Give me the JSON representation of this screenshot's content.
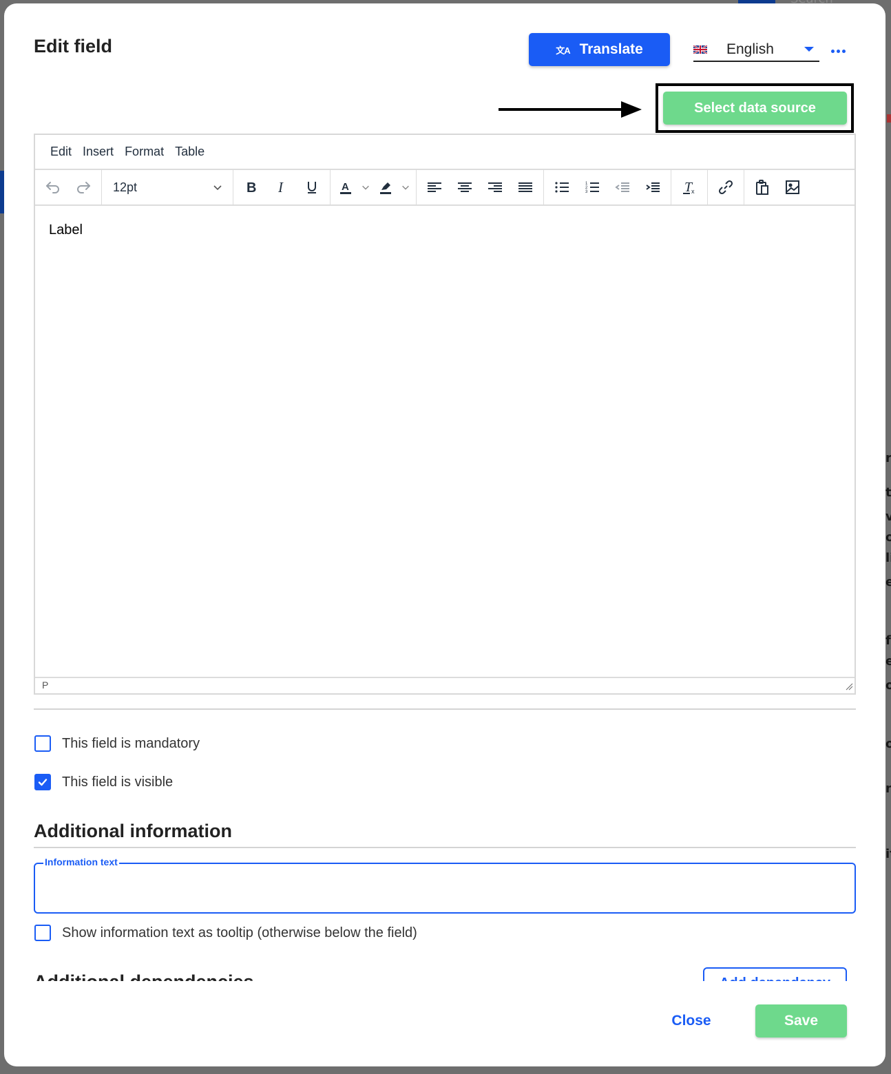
{
  "background": {
    "search_placeholder": "Search",
    "right_edge_fragments": [
      "re",
      "ti",
      "v",
      "ot",
      "li",
      "e",
      "f",
      "ec",
      "o",
      "og",
      "n",
      "it"
    ]
  },
  "dialog": {
    "title": "Edit field",
    "translate_button": {
      "label": "Translate",
      "icon": "translate-icon"
    },
    "language": {
      "selected": "English",
      "flag": "uk-flag-icon"
    },
    "more_menu": {
      "icon": "more-horizontal-icon"
    },
    "select_data_source_button": {
      "label": "Select data source",
      "highlighted": true
    }
  },
  "editor": {
    "menubar": [
      "Edit",
      "Insert",
      "Format",
      "Table"
    ],
    "toolbar": {
      "undo": "undo-icon",
      "redo": "redo-icon",
      "font_size": "12pt",
      "formatting": [
        "bold-icon",
        "italic-icon",
        "underline-icon"
      ],
      "colors": [
        "text-color-icon",
        "highlight-color-icon"
      ],
      "alignment": [
        "align-left-icon",
        "align-center-icon",
        "align-right-icon",
        "align-justify-icon"
      ],
      "lists": [
        "bullet-list-icon",
        "numbered-list-icon",
        "outdent-icon",
        "indent-icon"
      ],
      "clear_formatting": "clear-formatting-icon",
      "link": "link-icon",
      "paste": "paste-icon",
      "image": "image-icon"
    },
    "content": "Label",
    "status_path": "P"
  },
  "options": {
    "mandatory": {
      "label": "This field is mandatory",
      "checked": false
    },
    "visible": {
      "label": "This field is visible",
      "checked": true
    }
  },
  "additional_information": {
    "title": "Additional information",
    "info_text": {
      "label": "Information text",
      "value": ""
    },
    "tooltip": {
      "label": "Show information text as tooltip (otherwise below the field)",
      "checked": false
    }
  },
  "additional_dependencies": {
    "title": "Additional dependencies",
    "add_button": "Add dependency"
  },
  "footer": {
    "close_label": "Close",
    "save_label": "Save"
  },
  "colors": {
    "primary": "#1a5cf5",
    "success": "#6ed98c",
    "text": "#222f3e"
  }
}
